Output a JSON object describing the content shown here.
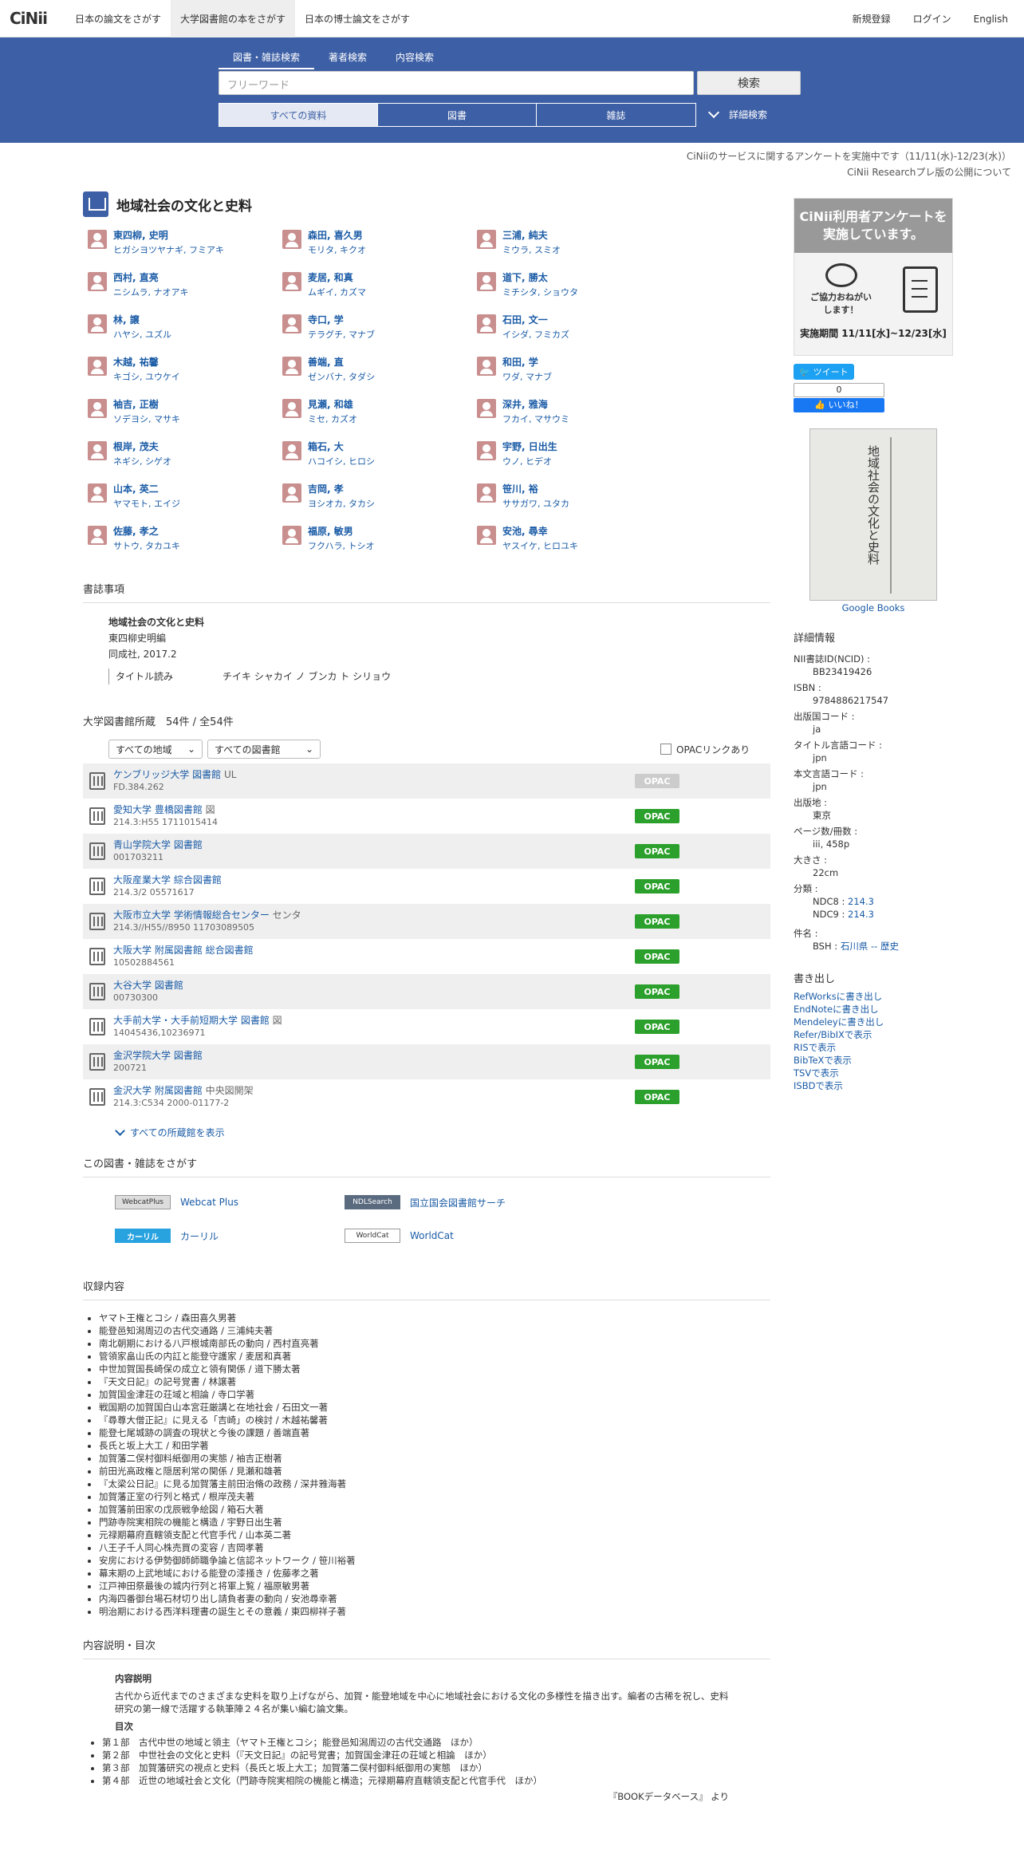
{
  "header": {
    "logo": "CiNii",
    "tabs": [
      "日本の論文をさがす",
      "大学図書館の本をさがす",
      "日本の博士論文をさがす"
    ],
    "right": [
      "新規登録",
      "ログイン",
      "English"
    ]
  },
  "search": {
    "tabs": [
      "図書・雑誌検索",
      "著者検索",
      "内容検索"
    ],
    "placeholder": "フリーワード",
    "button": "検索",
    "types": [
      "すべての資料",
      "図書",
      "雑誌"
    ],
    "advanced": "詳細検索"
  },
  "notices": [
    "CiNiiのサービスに関するアンケートを実施中です（11/11(水)-12/23(水)）",
    "CiNii Researchプレ版の公開について"
  ],
  "title": "地域社会の文化と史料",
  "authors": [
    {
      "name": "東四柳, 史明",
      "kana": "ヒガシヨツヤナギ, フミアキ"
    },
    {
      "name": "森田, 喜久男",
      "kana": "モリタ, キクオ"
    },
    {
      "name": "三浦, 純夫",
      "kana": "ミウラ, スミオ"
    },
    {
      "name": "西村, 直亮",
      "kana": "ニシムラ, ナオアキ"
    },
    {
      "name": "麦居, 和真",
      "kana": "ムギイ, カズマ"
    },
    {
      "name": "道下, 勝太",
      "kana": "ミチシタ, ショウタ"
    },
    {
      "name": "林, 譲",
      "kana": "ハヤシ, ユズル"
    },
    {
      "name": "寺口, 学",
      "kana": "テラグチ, マナブ"
    },
    {
      "name": "石田, 文一",
      "kana": "イシダ, フミカズ"
    },
    {
      "name": "木越, 祐馨",
      "kana": "キゴシ, ユウケイ"
    },
    {
      "name": "善端, 直",
      "kana": "ゼンバナ, タダシ"
    },
    {
      "name": "和田, 学",
      "kana": "ワダ, マナブ"
    },
    {
      "name": "袖吉, 正樹",
      "kana": "ソデヨシ, マサキ"
    },
    {
      "name": "見瀬, 和雄",
      "kana": "ミセ, カズオ"
    },
    {
      "name": "深井, 雅海",
      "kana": "フカイ, マサウミ"
    },
    {
      "name": "根岸, 茂夫",
      "kana": "ネギシ, シゲオ"
    },
    {
      "name": "箱石, 大",
      "kana": "ハコイシ, ヒロシ"
    },
    {
      "name": "宇野, 日出生",
      "kana": "ウノ, ヒデオ"
    },
    {
      "name": "山本, 英二",
      "kana": "ヤマモト, エイジ"
    },
    {
      "name": "吉岡, 孝",
      "kana": "ヨシオカ, タカシ"
    },
    {
      "name": "笹川, 裕",
      "kana": "ササガワ, ユタカ"
    },
    {
      "name": "佐藤, 孝之",
      "kana": "サトウ, タカユキ"
    },
    {
      "name": "福原, 敏男",
      "kana": "フクハラ, トシオ"
    },
    {
      "name": "安池, 尋幸",
      "kana": "ヤスイケ, ヒロユキ"
    }
  ],
  "biblio": {
    "heading": "書誌事項",
    "title": "地域社会の文化と史料",
    "editor": "東四柳史明編",
    "publisher": "同成社, 2017.2",
    "kana_label": "タイトル読み",
    "kana_value": "チイキ シャカイ ノ ブンカ ト シリョウ"
  },
  "holdings": {
    "heading": "大学図書館所蔵　54件 / 全54件",
    "region": "すべての地域",
    "library": "すべての図書館",
    "opac_filter": "OPACリンクあり",
    "show_all": "すべての所蔵館を表示",
    "rows": [
      {
        "name": "ケンブリッジ大学 図書館",
        "note": "UL",
        "code": "FD.384.262",
        "opac": "OPAC",
        "enabled": false
      },
      {
        "name": "愛知大学 豊橋図書館",
        "note": "図",
        "code": "214.3:H55  1711015414",
        "opac": "OPAC",
        "enabled": true
      },
      {
        "name": "青山学院大学 図書館",
        "note": "",
        "code": "001703211",
        "opac": "OPAC",
        "enabled": true
      },
      {
        "name": "大阪産業大学 綜合図書館",
        "note": "",
        "code": "214.3/2  05571617",
        "opac": "OPAC",
        "enabled": true
      },
      {
        "name": "大阪市立大学 学術情報総合センター",
        "note": "センタ",
        "code": "214.3//H55//8950  11703089505",
        "opac": "OPAC",
        "enabled": true
      },
      {
        "name": "大阪大学 附属図書館 総合図書館",
        "note": "",
        "code": "10502884561",
        "opac": "OPAC",
        "enabled": true
      },
      {
        "name": "大谷大学 図書館",
        "note": "",
        "code": "00730300",
        "opac": "OPAC",
        "enabled": true
      },
      {
        "name": "大手前大学・大手前短期大学 図書館",
        "note": "図",
        "code": "14045436,10236971",
        "opac": "OPAC",
        "enabled": true
      },
      {
        "name": "金沢学院大学 図書館",
        "note": "",
        "code": "200721",
        "opac": "OPAC",
        "enabled": true
      },
      {
        "name": "金沢大学 附属図書館",
        "note": "中央図開架",
        "code": "214.3:C534  2000-01177-2",
        "opac": "OPAC",
        "enabled": true
      }
    ]
  },
  "find": {
    "heading": "この図書・雑誌をさがす",
    "links": [
      {
        "badge": "WebcatPlus",
        "label": "Webcat Plus"
      },
      {
        "badge": "NDLSearch",
        "label": "国立国会図書館サーチ"
      },
      {
        "badge": "カーリル",
        "label": "カーリル"
      },
      {
        "badge": "WorldCat",
        "label": "WorldCat"
      }
    ]
  },
  "contents": {
    "heading": "収録内容",
    "items": [
      "ヤマト王権とコシ / 森田喜久男著",
      "能登邑知潟周辺の古代交通路 / 三浦純夫著",
      "南北朝期における八戸根城南部氏の動向 / 西村直亮著",
      "管領家畠山氏の内訌と能登守護家 / 麦居和真著",
      "中世加賀国長崎保の成立と領有関係 / 道下勝太著",
      "『天文日記』の記号覚書 / 林譲著",
      "加賀国金津荘の荘域と相論 / 寺口学著",
      "戦国期の加賀国白山本宮荘厳講と在地社会 / 石田文一著",
      "『尋尊大僧正記』に見える「吉崎」の検討 / 木越祐馨著",
      "能登七尾城跡の調査の現状と今後の課題 / 善端直著",
      "長氏と坂上大工 / 和田学著",
      "加賀藩二俣村御料紙御用の実態 / 袖吉正樹著",
      "前田光高政権と隠居利常の関係 / 見瀬和雄著",
      "『太梁公日記』に見る加賀藩主前田治脩の政務 / 深井雅海著",
      "加賀藩正室の行列と格式 / 根岸茂夫著",
      "加賀藩前田家の戊辰戦争絵図 / 箱石大著",
      "門跡寺院実相院の機能と構造 / 宇野日出生著",
      "元禄期幕府直轄領支配と代官手代 / 山本英二著",
      "八王子千人同心株売買の変容 / 吉岡孝著",
      "安房における伊勢御師師職争論と信認ネットワーク / 笹川裕著",
      "幕末期の上武地域における能登の漆掻き / 佐藤孝之著",
      "江戸神田祭最後の城内行列と将軍上覧 / 福原敏男著",
      "内海四番御台場石材切り出し請負者妻の動向 / 安池尋幸著",
      "明治期における西洋料理書の誕生とその意義 / 東四柳祥子著"
    ]
  },
  "description": {
    "heading": "内容説明・目次",
    "desc_label": "内容説明",
    "desc_text": "古代から近代までのさまざまな史料を取り上げながら、加賀・能登地域を中心に地域社会における文化の多様性を描き出す。編者の古稀を祝し、史料研究の第一線で活躍する執筆陣２４名が集い編む論文集。",
    "toc_label": "目次",
    "toc": [
      "第１部　古代中世の地域と領主（ヤマト王権とコシ；能登邑知潟周辺の古代交通路　ほか）",
      "第２部　中世社会の文化と史料（『天文日記』の記号覚書；加賀国金津荘の荘域と相論　ほか）",
      "第３部　加賀藩研究の視点と史料（長氏と坂上大工；加賀藩二俣村御料紙御用の実態　ほか）",
      "第４部　近世の地域社会と文化（門跡寺院実相院の機能と構造；元禄期幕府直轄領支配と代官手代　ほか）"
    ],
    "source": "『BOOKデータベース』 より"
  },
  "side": {
    "banner_title": "CiNii利用者アンケートを実施しています。",
    "banner_sub": "ご協力おねがいします！",
    "banner_period": "実施期間 11/11[水]~12/23[水]",
    "tweet": "ツイート",
    "like_count": "0",
    "like": "いいね！",
    "cover_caption": "Google Books",
    "detail_heading": "詳細情報",
    "details": [
      {
        "k": "NII書誌ID(NCID)",
        "v": "BB23419426"
      },
      {
        "k": "ISBN",
        "v": "9784886217547"
      },
      {
        "k": "出版国コード",
        "v": "ja"
      },
      {
        "k": "タイトル言語コード",
        "v": "jpn"
      },
      {
        "k": "本文言語コード",
        "v": "jpn"
      },
      {
        "k": "出版地",
        "v": "東京"
      },
      {
        "k": "ページ数/冊数",
        "v": "iii, 458p"
      },
      {
        "k": "大きさ",
        "v": "22cm"
      }
    ],
    "class_label": "分類",
    "ndc8": "NDC8",
    "ndc8_v": "214.3",
    "ndc9": "NDC9",
    "ndc9_v": "214.3",
    "subject_label": "件名",
    "bsh": "BSH",
    "bsh_v": "石川県 -- 歴史",
    "export_heading": "書き出し",
    "exports": [
      "RefWorksに書き出し",
      "EndNoteに書き出し",
      "Mendeleyに書き出し",
      "Refer/BibIXで表示",
      "RISで表示",
      "BibTeXで表示",
      "TSVで表示",
      "ISBDで表示"
    ]
  }
}
